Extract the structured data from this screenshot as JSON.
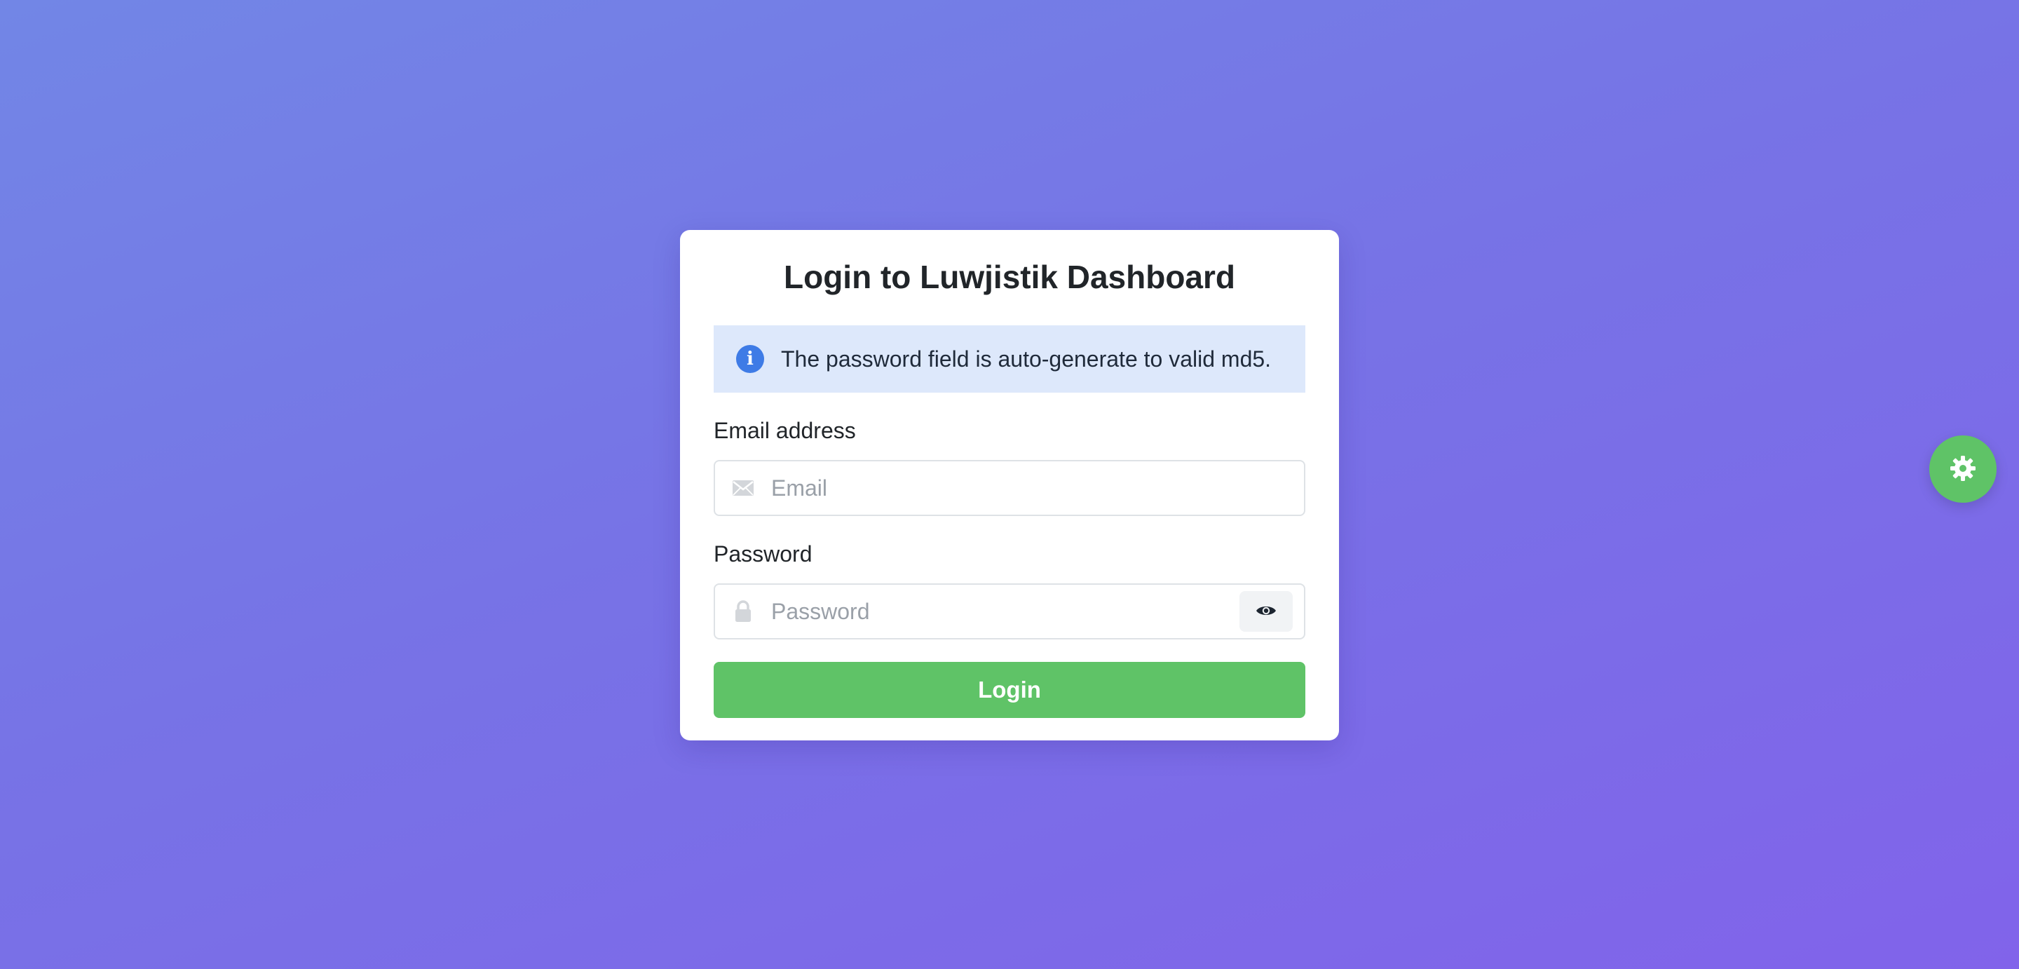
{
  "login": {
    "title": "Login to Luwjistik Dashboard",
    "alert_text": "The password field is auto-generate to valid md5.",
    "email_label": "Email address",
    "email_placeholder": "Email",
    "email_value": "",
    "password_label": "Password",
    "password_placeholder": "Password",
    "password_value": "",
    "submit_label": "Login"
  },
  "icons": {
    "alert": "info-icon",
    "email": "envelope-icon",
    "password": "lock-icon",
    "toggle": "eye-icon",
    "settings": "gear-icon"
  },
  "colors": {
    "primary_button": "#5fc367",
    "alert_background": "#dde8fb",
    "info_icon": "#3e7be6",
    "background_start": "#7286e6",
    "background_end": "#8163ea"
  }
}
